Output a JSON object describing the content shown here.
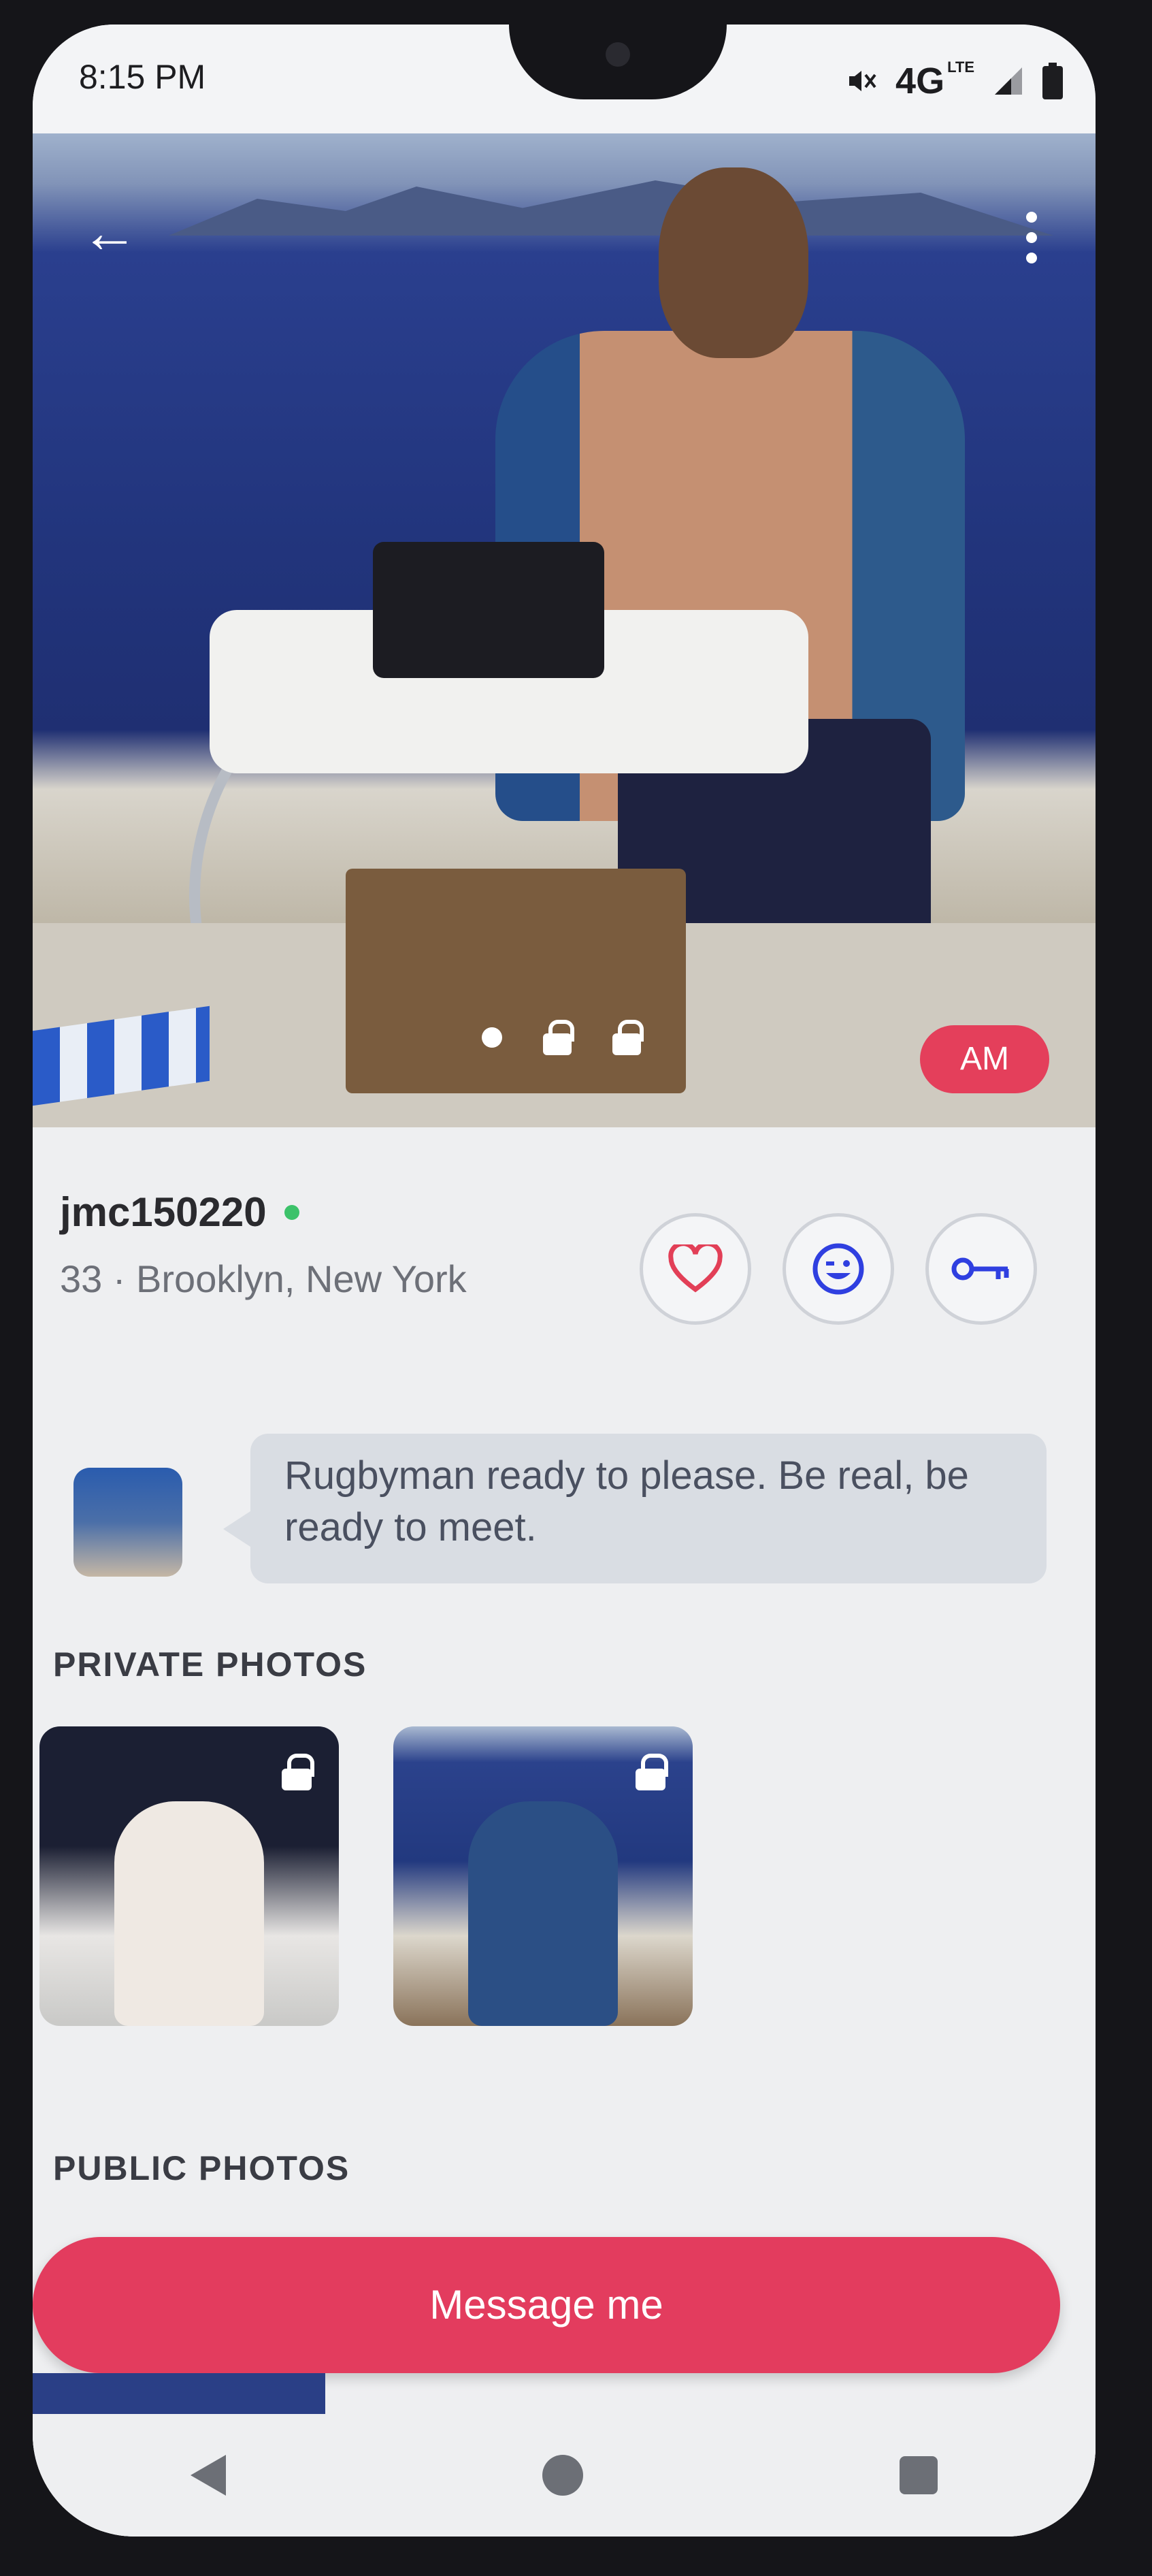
{
  "status_bar": {
    "time": "8:15 PM",
    "network": "4G",
    "network_sub": "LTE",
    "icons": [
      "mute-icon",
      "signal-icon",
      "battery-icon"
    ]
  },
  "hero": {
    "badge": "AM",
    "pager_icons": [
      "dot",
      "lock",
      "lock"
    ],
    "icons": [
      "back-arrow-icon",
      "more-vertical-icon"
    ]
  },
  "profile": {
    "username": "jmc150220",
    "online": true,
    "location": "33 · Brooklyn, New York",
    "actions": [
      {
        "name": "like",
        "icon": "heart-icon",
        "color": "#e23f57"
      },
      {
        "name": "wink",
        "icon": "wink-face-icon",
        "color": "#2f3fe0"
      },
      {
        "name": "key",
        "icon": "key-icon",
        "color": "#2f3fe0"
      }
    ],
    "about": "Rugbyman ready to please. Be real, be ready to meet."
  },
  "sections": {
    "private_label": "PRIVATE PHOTOS",
    "public_label": "PUBLIC PHOTOS"
  },
  "cta": {
    "message_label": "Message me"
  },
  "colors": {
    "accent": "#e33c5e",
    "online": "#3cc26a",
    "icon_blue": "#2f3fe0"
  }
}
